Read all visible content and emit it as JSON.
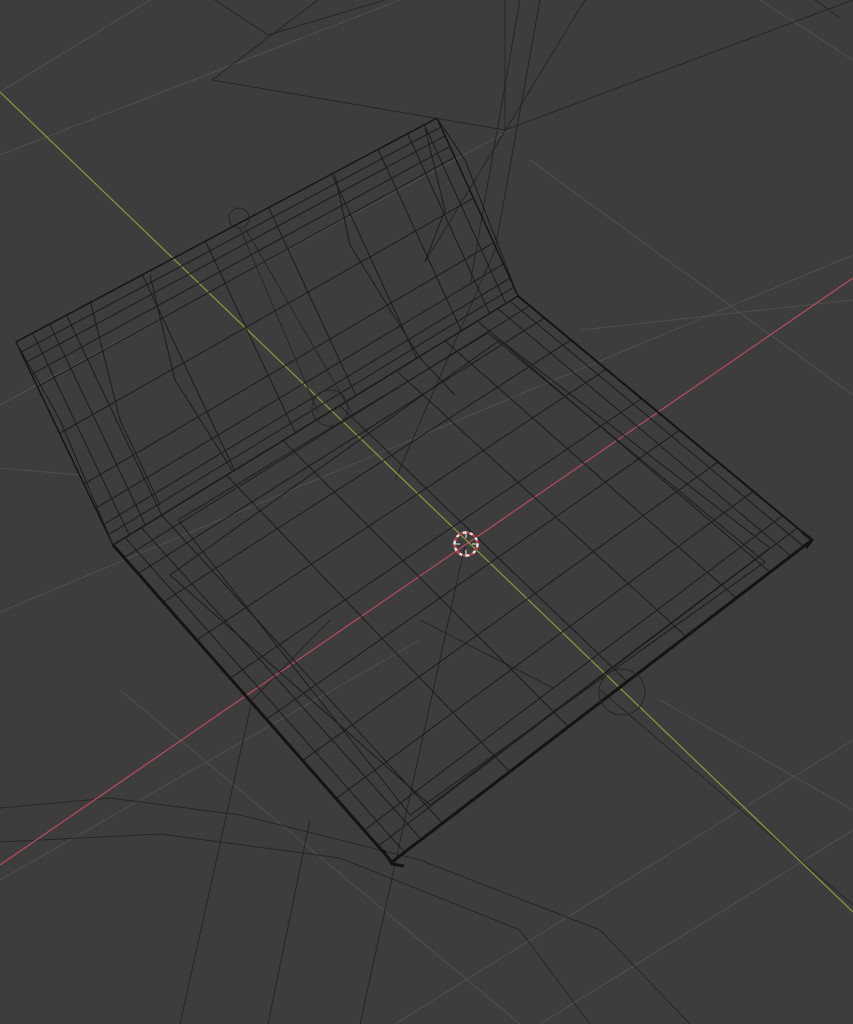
{
  "viewport": {
    "background_color": "#3d3d3d",
    "shading_mode": "wireframe",
    "colors": {
      "grid": "#4f4f4f",
      "axis_x": "#b84a5c",
      "axis_y": "#869c3a",
      "wire": "#1c1c1c",
      "wire_edge": "#141414",
      "aux_lines": "#262626",
      "cursor_primary": "#e4e4e4",
      "cursor_secondary": "#c84040"
    },
    "icons": {
      "cursor": "3d-cursor-icon",
      "light": "light-object-icon",
      "empty": "empty-object-icon"
    }
  }
}
